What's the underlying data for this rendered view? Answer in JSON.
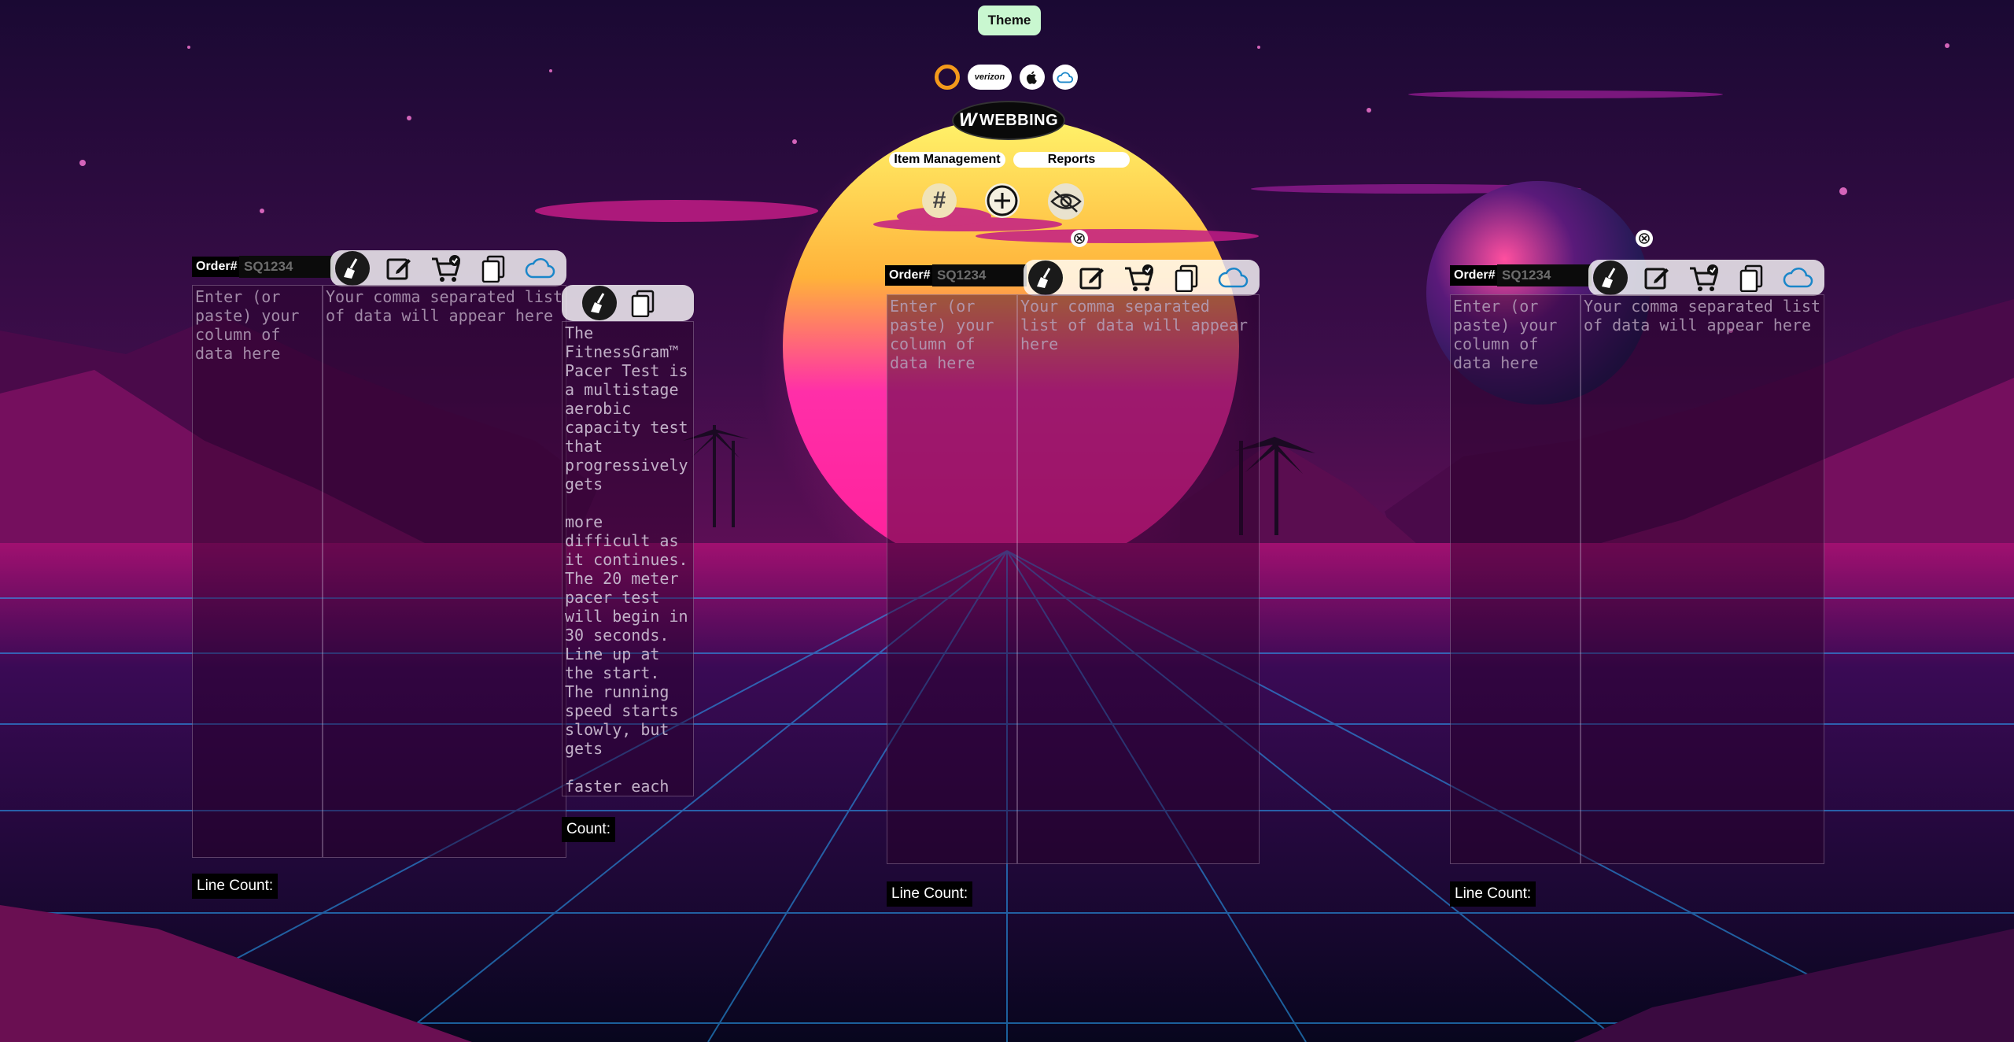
{
  "header": {
    "theme_label": "Theme",
    "carriers": [
      {
        "name": "ring-carrier",
        "icon": "orange-ring-icon",
        "color": "#f39a1b"
      },
      {
        "name": "verizon",
        "label": "verizon"
      },
      {
        "name": "apple",
        "icon": "apple-icon"
      },
      {
        "name": "cloud",
        "icon": "cloud-icon"
      }
    ],
    "logo_text": "WEBBING",
    "nav": {
      "item_management": "Item Management",
      "reports": "Reports"
    },
    "actions": [
      {
        "name": "hash",
        "label": "#"
      },
      {
        "name": "add",
        "icon": "plus-circle-icon"
      },
      {
        "name": "hide",
        "icon": "eye-slash-icon"
      }
    ]
  },
  "panels": [
    {
      "order_label": "Order#",
      "order_placeholder": "SQ1234",
      "input_placeholder": "Enter (or paste) your column of data here",
      "output_placeholder": "Your comma separated list of data will appear here",
      "count_label": "Line Count:"
    },
    {
      "order_label": "Order#",
      "order_placeholder": "SQ1234",
      "input_placeholder": "Enter (or paste) your column of data here",
      "output_placeholder": "Your comma separated list of data will appear here",
      "count_label": "Line Count:"
    },
    {
      "order_label": "Order#",
      "order_placeholder": "SQ1234",
      "input_placeholder": "Enter (or paste) your column of data here",
      "output_placeholder": "Your comma separated list of data will appear here",
      "count_label": "Line Count:"
    }
  ],
  "text_panel": {
    "text": "The FitnessGram™ Pacer Test is a multistage aerobic capacity test that progressively gets\n\nmore difficult as it continues. The 20 meter pacer test will begin in 30 seconds. Line up at the start. The running speed starts slowly, but gets\n\nfaster each",
    "count_label": "Count:"
  },
  "colors": {
    "accent_green": "#c9f7d0",
    "sun": "#ff2fa8",
    "grid": "#2aa8ff"
  }
}
